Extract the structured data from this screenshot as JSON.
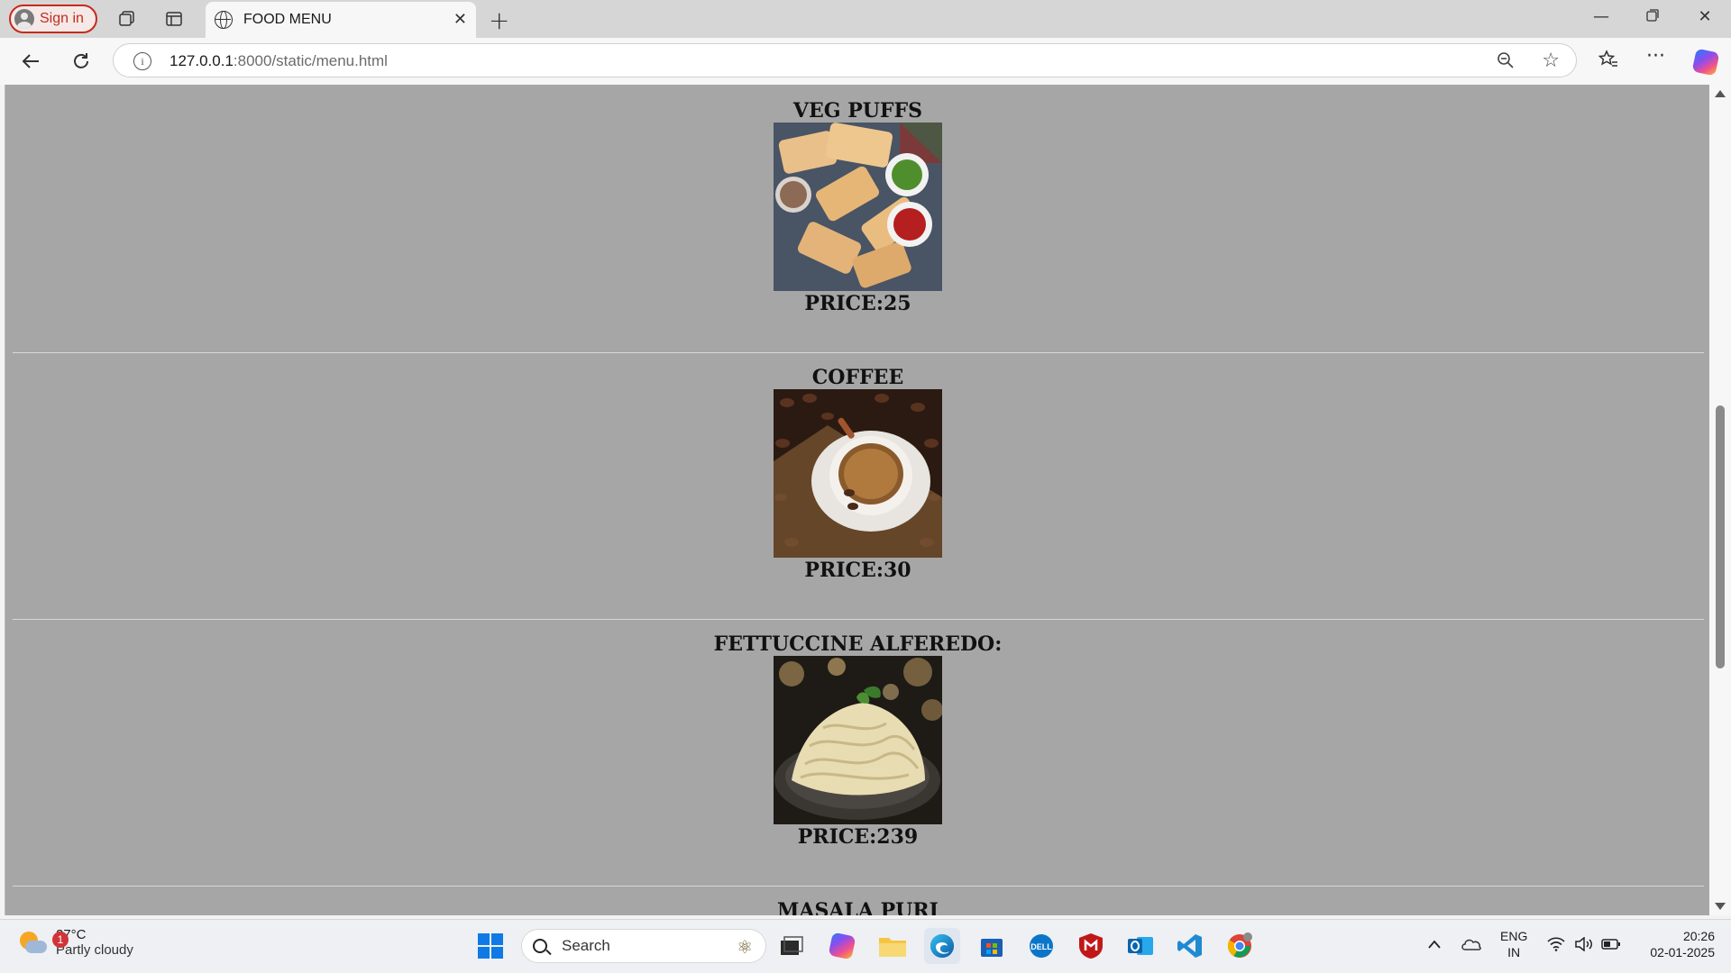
{
  "browser": {
    "signin_label": "Sign in",
    "tab_title": "FOOD MENU",
    "url_host": "127.0.0.1",
    "url_path": ":8000/static/menu.html"
  },
  "menu": {
    "items": [
      {
        "name": "VEG PUFFS",
        "price": "PRICE:25"
      },
      {
        "name": "COFFEE",
        "price": "PRICE:30"
      },
      {
        "name": "FETTUCCINE ALFEREDO:",
        "price": "PRICE:239"
      },
      {
        "name": "MASALA PURI"
      }
    ]
  },
  "taskbar": {
    "weather_badge": "1",
    "weather_temp": "27°C",
    "weather_condition": "Partly cloudy",
    "search_placeholder": "Search",
    "lang_top": "ENG",
    "lang_bottom": "IN",
    "time": "20:26",
    "date": "02-01-2025"
  },
  "colors": {
    "page_background": "#a6a6a6",
    "signin_accent": "#c42b1c",
    "edge_blue": "#0f6cbd"
  },
  "icons": {
    "workspaces": "workspaces-icon",
    "tab_actions": "tab-actions-icon",
    "back": "back-arrow-icon",
    "refresh": "refresh-icon",
    "favorites": "favorites-icon",
    "more": "more-icon"
  }
}
